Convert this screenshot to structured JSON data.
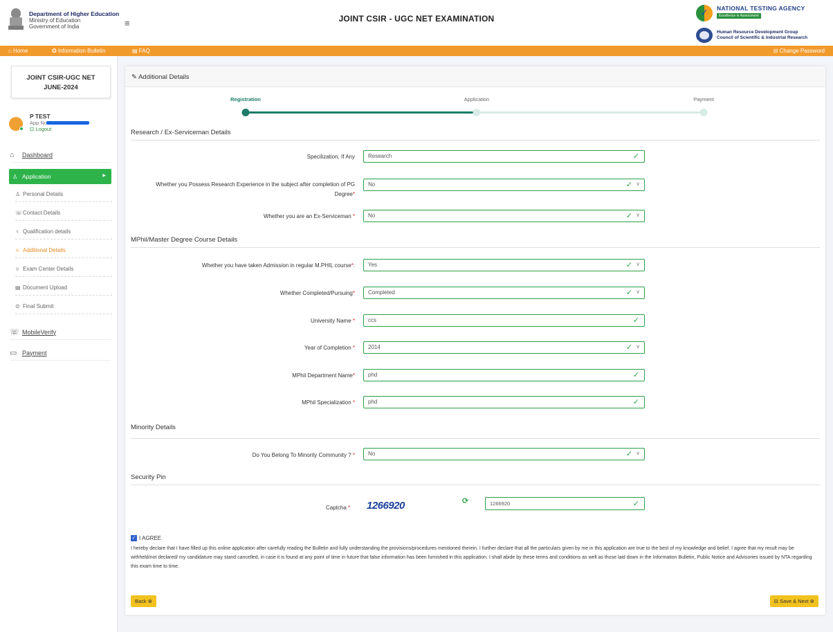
{
  "header": {
    "dept_line1": "Department of Higher Education",
    "dept_line2": "Ministry of Education",
    "dept_line3": "Government of India",
    "menu_icon": "hamburger-icon",
    "title": "JOINT CSIR - UGC NET EXAMINATION",
    "nta_title": "NATIONAL TESTING AGENCY",
    "nta_tagline": "Excellence in Assessment",
    "csir_line1": "Human Resource Development Group",
    "csir_line2": "Council of Scientific & Industrial Research"
  },
  "nav": {
    "home": "⌂ Home",
    "bulletin": "✪ Information Bulletin",
    "faq": "▤ FAQ",
    "change_password": "⊟ Change Password"
  },
  "sidebar": {
    "exam_line1": "JOINT CSIR-UGC NET",
    "exam_line2": "JUNE-2024",
    "user_name": "P TEST",
    "app_no_label": "App No :",
    "logout": "⊡ Logout",
    "dashboard": "Dashboard",
    "application": "Application",
    "sub_items": [
      {
        "icon": "♙",
        "label": "Personal Details"
      },
      {
        "icon": "☏",
        "label": "Contact Details"
      },
      {
        "icon": "♀",
        "label": "Qualification details"
      },
      {
        "icon": "♅",
        "label": "Additional Details"
      },
      {
        "icon": "♅",
        "label": "Exam Center Details"
      },
      {
        "icon": "▤",
        "label": "Document Upload"
      },
      {
        "icon": "⊙",
        "label": "Final Submit"
      }
    ],
    "mobile_verify": "MobileVerify",
    "payment": "Payment"
  },
  "card": {
    "title": "✎ Additional Details",
    "steps": [
      "Registration",
      "Application",
      "Payment"
    ]
  },
  "sections": {
    "research": "Research / Ex-Serviceman Details",
    "mphil": "MPhil/Master Degree Course Details",
    "minority": "Minority Details",
    "security": "Security Pin"
  },
  "fields": {
    "specialization": {
      "label": "Specilization, If Any",
      "value": "Research"
    },
    "research_exp": {
      "label1": "Whether you Possess Research Experience in the subject after completion of PG",
      "label2": "Degree",
      "value": "No"
    },
    "ex_serviceman": {
      "label": "Whether you are an Ex-Serviceman",
      "value": "No"
    },
    "mphil_admission": {
      "label": "Whether you have taken Admission in regular M.PHIL course",
      "value": "Yes"
    },
    "completed": {
      "label": "Whether Completed/Pursuing",
      "value": "Completed"
    },
    "university": {
      "label": "University Name",
      "value": "ccs"
    },
    "year": {
      "label": "Year of Completion",
      "value": "2014"
    },
    "dept": {
      "label": "MPhil Department Name",
      "value": "phd"
    },
    "mphil_spec": {
      "label": "MPhil Specialization",
      "value": "phd"
    },
    "minority": {
      "label": "Do You Belong To Minority Community ?",
      "value": "No"
    }
  },
  "captcha": {
    "label": "Captcha",
    "image_text": "1266920",
    "value": "1266920"
  },
  "agree": {
    "label": "I AGREE",
    "text": "I hereby declare that I have filled up this online application after carefully reading the Bulletin and fully understanding the provisions/procedures mentioned therein. I further declare that all the particulars given by me in this application are true to the best of my knowledge and belief. I agree that my result may be withheld/not declared/ my candidature may stand cancelled, in case it is found at any point of time in future that false information has been furnished in this application. I shall abide by these terms and conditions as well as those laid down in the Information Bulletin, Public Notice and Advisories issued by NTA regarding this exam time to time."
  },
  "buttons": {
    "back": "Back ⊕",
    "save_next": "⊟ Save & Next ⊕"
  },
  "colors": {
    "orange_bar": "#f19a2c",
    "active_green": "#2db34a",
    "field_green": "#2aa046",
    "button_yellow": "#f2c21f",
    "step_teal": "#1c7c67"
  }
}
